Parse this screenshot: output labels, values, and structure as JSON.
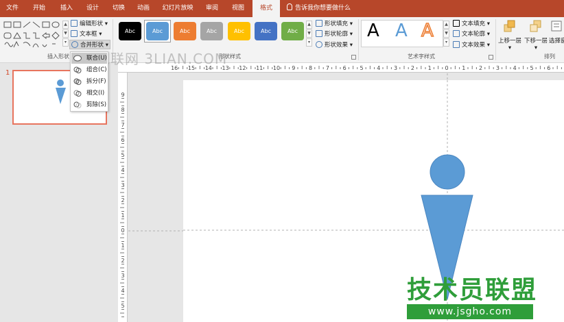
{
  "tabs": [
    {
      "label": "文件"
    },
    {
      "label": "开始"
    },
    {
      "label": "插入"
    },
    {
      "label": "设计"
    },
    {
      "label": "切换"
    },
    {
      "label": "动画"
    },
    {
      "label": "幻灯片放映"
    },
    {
      "label": "审阅"
    },
    {
      "label": "视图"
    },
    {
      "label": "格式",
      "active": true
    }
  ],
  "tell_me": "告诉我你想要做什么",
  "insert_shapes": {
    "edit_shape": "编辑形状",
    "text_box": "文本框",
    "merge_shapes": "合并形状",
    "group_label": "插入形状"
  },
  "shape_styles": {
    "label": "Abc",
    "colors": [
      "#000000",
      "#5b9bd5",
      "#ed7d31",
      "#a5a5a5",
      "#ffc000",
      "#4472c4",
      "#70ad47"
    ],
    "fill": "形状填充",
    "outline": "形状轮廓",
    "effects": "形状效果",
    "group_label": "形状样式"
  },
  "wordart": {
    "letter": "A",
    "text_fill": "文本填充",
    "text_outline": "文本轮廓",
    "text_effects": "文本效果",
    "group_label": "艺术字样式"
  },
  "arrange": {
    "bring_forward": "上移一层",
    "send_backward": "下移一层",
    "selection": "选择窗",
    "group_label": "排列"
  },
  "merge_menu": [
    {
      "label": "联合(U)",
      "highlighted": true
    },
    {
      "label": "组合(C)"
    },
    {
      "label": "拆分(F)"
    },
    {
      "label": "相交(I)"
    },
    {
      "label": "剪除(S)"
    }
  ],
  "slide_pane": {
    "number": "1"
  },
  "ruler": {
    "h_labels": [
      "16",
      "15",
      "14",
      "13",
      "12",
      "11",
      "10",
      "9",
      "8",
      "7",
      "6",
      "5",
      "4",
      "3",
      "2",
      "1",
      "0",
      "1",
      "2",
      "3",
      "4",
      "5",
      "6",
      "7"
    ],
    "v_labels": [
      "9",
      "8",
      "7",
      "6",
      "5",
      "4",
      "3",
      "2",
      "1",
      "0",
      "1",
      "2",
      "3",
      "4",
      "5"
    ]
  },
  "watermarks": {
    "top": "三联网 3LIAN.COM",
    "logo_text": "技术员联盟",
    "logo_url": "www.jsgho.com"
  },
  "colors": {
    "accent": "#b7472a",
    "shape_fill": "#5b9bd5",
    "thumb_border": "#e8745d"
  }
}
